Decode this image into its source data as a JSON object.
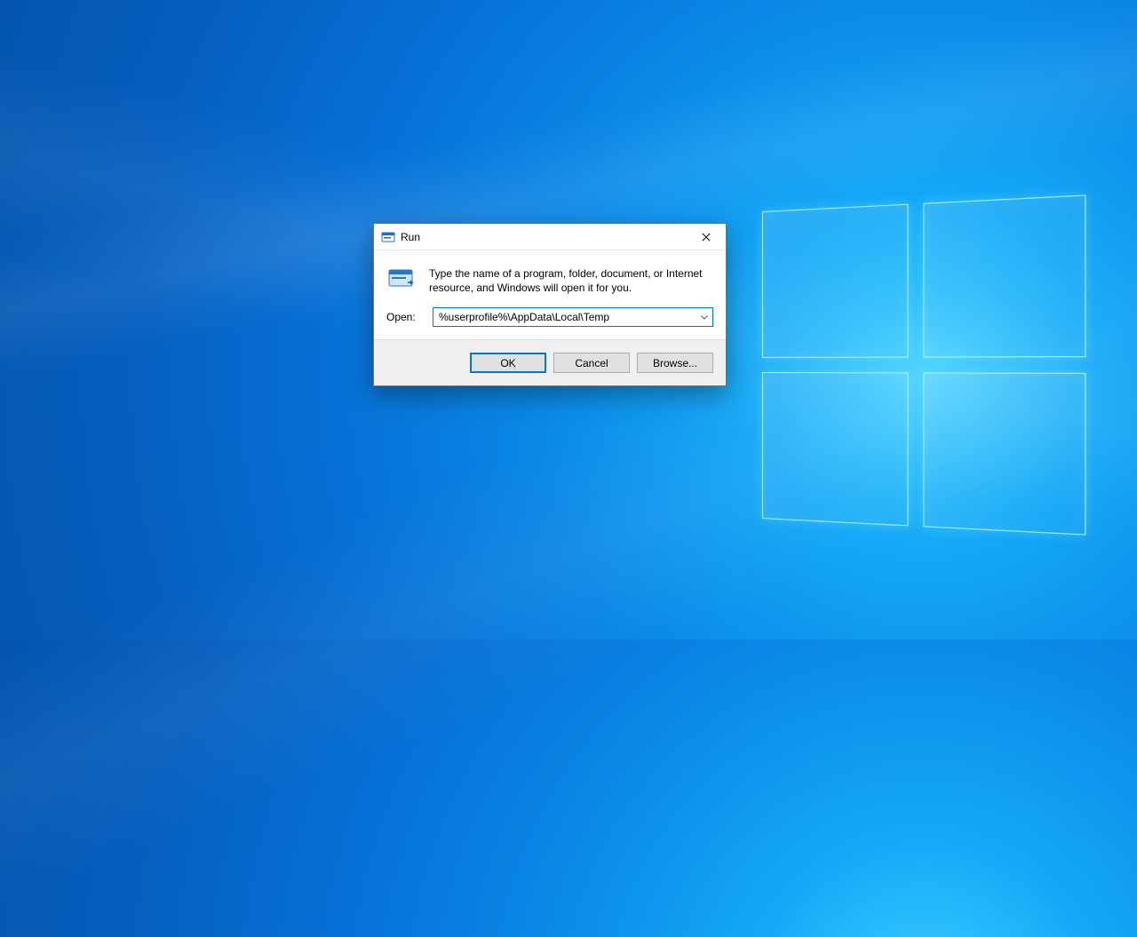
{
  "dialog": {
    "title": "Run",
    "description": "Type the name of a program, folder, document, or Internet resource, and Windows will open it for you.",
    "open_label": "Open:",
    "open_value": "%userprofile%\\AppData\\Local\\Temp",
    "buttons": {
      "ok": "OK",
      "cancel": "Cancel",
      "browse": "Browse..."
    }
  },
  "icons": {
    "app_icon": "run-app-icon",
    "close": "close-icon",
    "run_big": "run-folder-icon",
    "chevron": "chevron-down-icon"
  },
  "colors": {
    "accent": "#0078d7",
    "button_face": "#e1e1e1",
    "button_strip": "#f0f0f0"
  }
}
